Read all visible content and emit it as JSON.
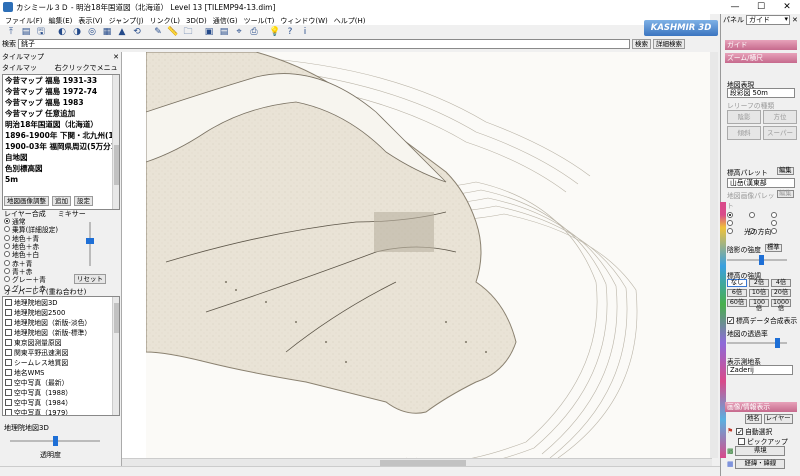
{
  "window": {
    "title": "カシミール３Ｄ - 明治18年国道図（北海道） Level 13 [TILEMP94-13.dim]",
    "min": "—",
    "max": "☐",
    "close": "✕"
  },
  "menu": [
    "ファイル(F)",
    "編集(E)",
    "表示(V)",
    "ジャンプ(J)",
    "リンク(L)",
    "3D(D)",
    "通信(G)",
    "ツール(T)",
    "ウィンドウ(W)",
    "ヘルプ(H)"
  ],
  "toolbar_icons": [
    "jump-icon",
    "open-icon",
    "save-icon",
    "globe-icon",
    "globe2-icon",
    "world-icon",
    "map-icon",
    "mountain-icon",
    "rotate-icon",
    "pencil-icon",
    "ruler-icon",
    "folder-icon",
    "camera-icon",
    "layers-icon",
    "gps-icon",
    "print-icon",
    "lamp-icon",
    "help-icon",
    "info-icon"
  ],
  "toolbar_glyphs": [
    "⤒",
    "▤",
    "🖫",
    "◐",
    "◑",
    "◎",
    "▦",
    "▲",
    "⟲",
    "✎",
    "📏",
    "🗀",
    "▣",
    "▤",
    "⌖",
    "⎙",
    "💡",
    "?",
    "i"
  ],
  "brand": "KASHMIR 3D",
  "search": {
    "label": "検索",
    "value": "銚子",
    "button": "検索",
    "detail_button": "詳細検索"
  },
  "left": {
    "panel_title": "タイルマップ",
    "close": "✕",
    "tile_tab": "タイルマップ",
    "tile_hint": "右クリックでメニュー",
    "tiles": [
      "今昔マップ 福島 1931-33",
      "今昔マップ 福島 1972-74",
      "今昔マップ 福島 1983",
      "今昔マップ 任意追加",
      "明治18年国道図（北海道）",
      "1896-1900年 下関・北九州(1万ｶ",
      "1900-03年 福岡県周辺(5万分1)",
      "自地図",
      "色別標高図",
      "5m"
    ],
    "btn_adjust": "地図画像調整",
    "btn_add": "追加",
    "btn_settings": "設定",
    "layer_label": "レイヤー合成",
    "mixer_label": "ミキサー",
    "layer_modes": [
      "通常",
      "乗算(詳細設定)",
      "地色＋青",
      "地色＋赤",
      "地色＋白",
      "赤＋青",
      "青＋赤",
      "グレー＋青",
      "グレー＋赤"
    ],
    "reset": "リセット",
    "overlay_label": "オーバーレイ(重ね合わせ)",
    "overlays": [
      "地理院地図3D",
      "地理院地図2500",
      "地理院地図（新版-淡色）",
      "地理院地図（新版-標準）",
      "東京図測量原図",
      "関東平野迅速測図",
      "シームレス地質図",
      "地名WMS",
      "空中写真（最新）",
      "空中写真（1988）",
      "空中写真（1984）",
      "空中写真（1979）"
    ],
    "three_d_label": "地理院地図3D",
    "transparency": "透明度",
    "transparency_value": 0.5
  },
  "right": {
    "panel_label": "パネル",
    "panel_select": "ガイド",
    "s_guide": "ガイド",
    "s_zoom": "ズーム/横尺",
    "map_display": "地図表現",
    "map_display_value": "段彩図 50m",
    "relief_label": "レリーフの種類",
    "relief_btns": [
      "陰影",
      "方位",
      "傾斜",
      "スーパー"
    ],
    "pal_label": "標高パレット",
    "pal_edit": "編集",
    "pal_value": "山岳(漢東部",
    "pal2_label": "地図画像パレット",
    "pal2_edit": "編集",
    "light_label": "光の方向",
    "shadow_label": "陰影の強度",
    "std": "標準",
    "emph_label": "標高の強調",
    "emph_btns": [
      "なし",
      "2倍",
      "4倍",
      "6倍",
      "10倍",
      "20倍",
      "60倍",
      "100倍",
      "1000倍"
    ],
    "synth_label": "標高データ合成表示",
    "map_trans": "地図の透過率",
    "datum_label": "表示測地系",
    "datum_value": "Zaderij",
    "s_names": "画像/情報表示",
    "name_btn": "地名",
    "layer_btn": "レイヤー",
    "auto_select": "自動選択",
    "pickup": "ピックアップ",
    "pref_btn": "県境",
    "grid_btn": "経緯・緯線"
  }
}
